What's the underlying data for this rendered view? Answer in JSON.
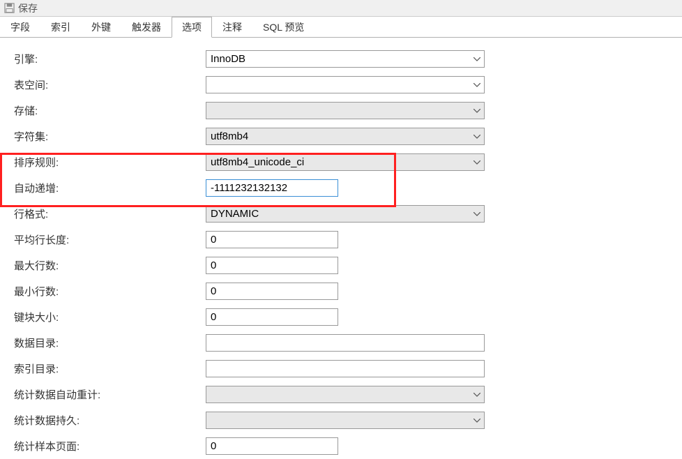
{
  "toolbar": {
    "save_label": "保存"
  },
  "tabs": [
    {
      "id": "fields",
      "label": "字段"
    },
    {
      "id": "index",
      "label": "索引"
    },
    {
      "id": "fk",
      "label": "外键"
    },
    {
      "id": "trigger",
      "label": "触发器"
    },
    {
      "id": "options",
      "label": "选项"
    },
    {
      "id": "comment",
      "label": "注释"
    },
    {
      "id": "sqlpreview",
      "label": "SQL 预览"
    }
  ],
  "active_tab": "options",
  "form": {
    "engine": {
      "label": "引擎:",
      "value": "InnoDB"
    },
    "tablespace": {
      "label": "表空间:",
      "value": ""
    },
    "storage": {
      "label": "存储:",
      "value": ""
    },
    "charset": {
      "label": "字符集:",
      "value": "utf8mb4"
    },
    "collation": {
      "label": "排序规则:",
      "value": "utf8mb4_unicode_ci"
    },
    "auto_incr": {
      "label": "自动递增:",
      "value": "-1111232132132"
    },
    "row_format": {
      "label": "行格式:",
      "value": "DYNAMIC"
    },
    "avg_row_len": {
      "label": "平均行长度:",
      "value": "0"
    },
    "max_rows": {
      "label": "最大行数:",
      "value": "0"
    },
    "min_rows": {
      "label": "最小行数:",
      "value": "0"
    },
    "key_block": {
      "label": "键块大小:",
      "value": "0"
    },
    "data_dir": {
      "label": "数据目录:",
      "value": ""
    },
    "index_dir": {
      "label": "索引目录:",
      "value": ""
    },
    "stats_recalc": {
      "label": "统计数据自动重计:",
      "value": ""
    },
    "stats_persist": {
      "label": "统计数据持久:",
      "value": ""
    },
    "stats_sample": {
      "label": "统计样本页面:",
      "value": "0"
    }
  }
}
